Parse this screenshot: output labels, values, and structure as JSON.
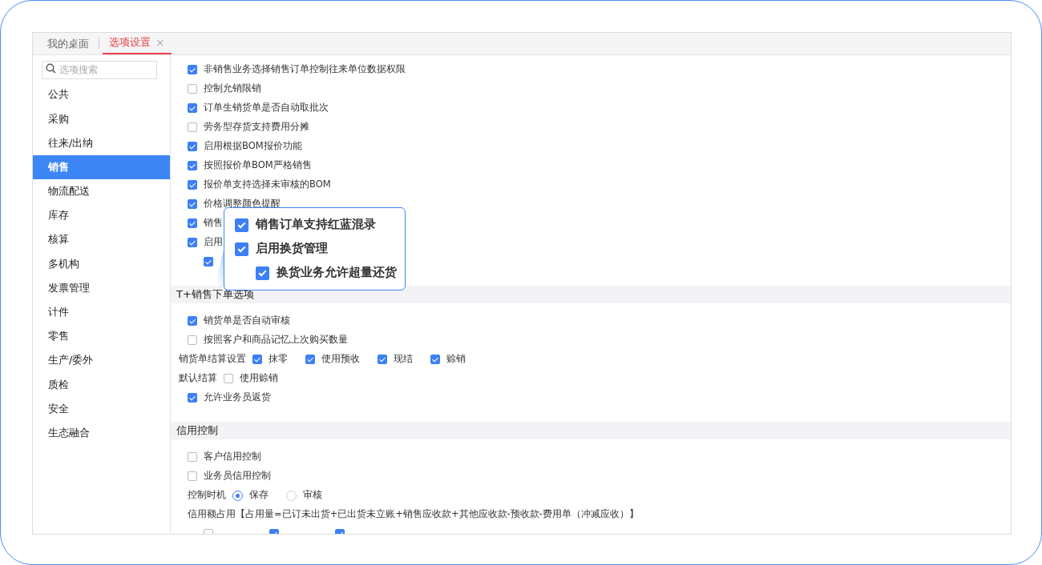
{
  "tabs": [
    {
      "label": "我的桌面",
      "selected": false
    },
    {
      "label": "选项设置",
      "selected": true,
      "close": "×"
    }
  ],
  "search": {
    "placeholder": "选项搜索"
  },
  "sidebar": {
    "items": [
      {
        "label": "公共",
        "selected": false
      },
      {
        "label": "采购",
        "selected": false
      },
      {
        "label": "往来/出纳",
        "selected": false
      },
      {
        "label": "销售",
        "selected": true
      },
      {
        "label": "物流配送",
        "selected": false
      },
      {
        "label": "库存",
        "selected": false
      },
      {
        "label": "核算",
        "selected": false
      },
      {
        "label": "多机构",
        "selected": false
      },
      {
        "label": "发票管理",
        "selected": false
      },
      {
        "label": "计件",
        "selected": false
      },
      {
        "label": "零售",
        "selected": false
      },
      {
        "label": "生产/委外",
        "selected": false
      },
      {
        "label": "质检",
        "selected": false
      },
      {
        "label": "安全",
        "selected": false
      },
      {
        "label": "生态融合",
        "selected": false
      }
    ]
  },
  "sections": [
    {
      "rows": [
        {
          "kind": "checkbox",
          "label": "非销售业务选择销售订单控制往来单位数据权限",
          "checked": true
        },
        {
          "kind": "checkbox",
          "label": "控制允销限销",
          "checked": false
        },
        {
          "kind": "checkbox",
          "label": "订单生销货单是否自动取批次",
          "checked": true
        },
        {
          "kind": "checkbox",
          "label": "劳务型存货支持费用分摊",
          "checked": false
        },
        {
          "kind": "checkbox",
          "label": "启用根据BOM报价功能",
          "checked": true
        },
        {
          "kind": "checkbox",
          "label": "按照报价单BOM严格销售",
          "checked": true
        },
        {
          "kind": "checkbox",
          "label": "报价单支持选择未审核的BOM",
          "checked": true
        },
        {
          "kind": "checkbox",
          "label": "价格调整颜色提醒",
          "checked": true
        },
        {
          "kind": "checkbox",
          "label": "销售",
          "checked": true
        },
        {
          "kind": "checkbox",
          "label": "启用",
          "checked": true,
          "children": [
            {
              "kind": "checkbox",
              "checked": true
            }
          ]
        }
      ]
    },
    {
      "title": "T+销售下单选项",
      "rows": [
        {
          "kind": "checkbox",
          "label": "销货单是否自动审核",
          "checked": true
        },
        {
          "kind": "checkbox",
          "label": "按照客户和商品记忆上次购买数量",
          "checked": false
        },
        {
          "kind": "inline",
          "label": "销货单结算设置",
          "options": [
            {
              "label": "抹零",
              "checked": true
            },
            {
              "label": "使用预收",
              "checked": true
            },
            {
              "label": "现结",
              "checked": true
            },
            {
              "label": "赊销",
              "checked": true
            }
          ]
        },
        {
          "kind": "inline",
          "label": "默认结算",
          "options": [
            {
              "label": "使用赊销",
              "checked": false
            }
          ]
        },
        {
          "kind": "checkbox",
          "label": "允许业务员返货",
          "checked": true
        }
      ]
    },
    {
      "title": "信用控制",
      "rows": [
        {
          "kind": "checkbox",
          "label": "客户信用控制",
          "checked": false
        },
        {
          "kind": "checkbox",
          "label": "业务员信用控制",
          "checked": false
        },
        {
          "kind": "radio",
          "label": "控制时机",
          "options": [
            {
              "label": "保存",
              "selected": true
            },
            {
              "label": "审核",
              "selected": false
            }
          ]
        },
        {
          "kind": "text",
          "label": "信用额占用【占用量=已订未出货+已出货未立账+销售应收款+其他应收款-预收款-费用单（冲减应收）】"
        },
        {
          "kind": "boxes",
          "options": [
            {
              "checked": false
            },
            {
              "checked": true
            },
            {
              "checked": true
            }
          ]
        }
      ]
    }
  ],
  "callout": {
    "items": [
      {
        "label": "销售订单支持红蓝混录",
        "checked": true
      },
      {
        "label": "启用换货管理",
        "checked": true,
        "children": [
          {
            "label": "换货业务允许超量还货",
            "checked": true
          }
        ]
      }
    ]
  }
}
